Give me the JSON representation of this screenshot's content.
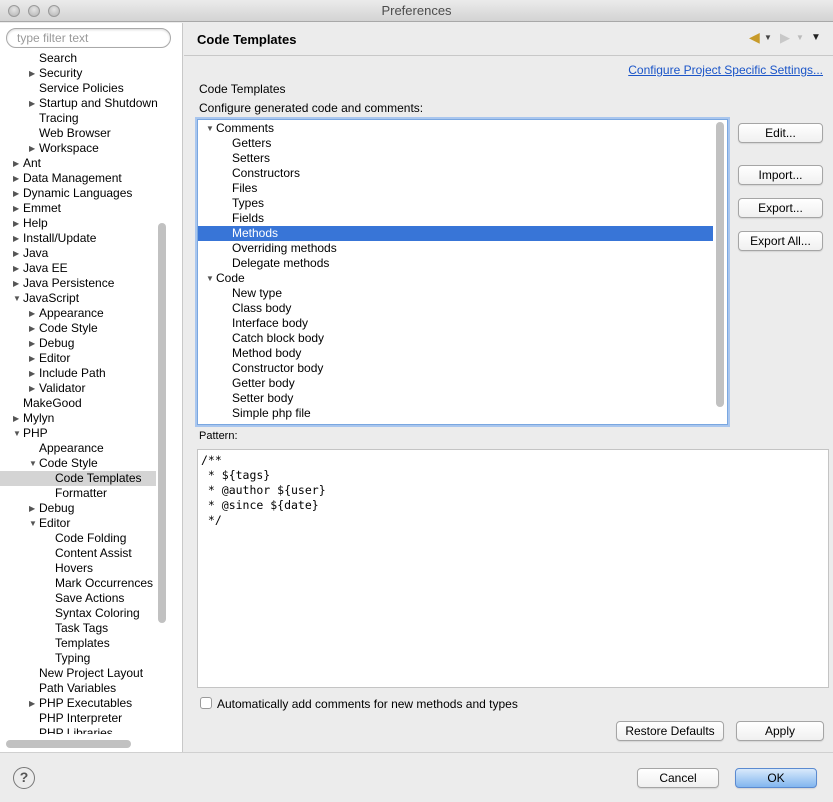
{
  "window": {
    "title": "Preferences"
  },
  "filter": {
    "placeholder": "type filter text"
  },
  "tree": [
    {
      "label": "Search",
      "level": 2,
      "twisty": ""
    },
    {
      "label": "Security",
      "level": 2,
      "twisty": "closed"
    },
    {
      "label": "Service Policies",
      "level": 2,
      "twisty": ""
    },
    {
      "label": "Startup and Shutdown",
      "level": 2,
      "twisty": "closed"
    },
    {
      "label": "Tracing",
      "level": 2,
      "twisty": ""
    },
    {
      "label": "Web Browser",
      "level": 2,
      "twisty": ""
    },
    {
      "label": "Workspace",
      "level": 2,
      "twisty": "closed"
    },
    {
      "label": "Ant",
      "level": 1,
      "twisty": "closed"
    },
    {
      "label": "Data Management",
      "level": 1,
      "twisty": "closed"
    },
    {
      "label": "Dynamic Languages",
      "level": 1,
      "twisty": "closed"
    },
    {
      "label": "Emmet",
      "level": 1,
      "twisty": "closed"
    },
    {
      "label": "Help",
      "level": 1,
      "twisty": "closed"
    },
    {
      "label": "Install/Update",
      "level": 1,
      "twisty": "closed"
    },
    {
      "label": "Java",
      "level": 1,
      "twisty": "closed"
    },
    {
      "label": "Java EE",
      "level": 1,
      "twisty": "closed"
    },
    {
      "label": "Java Persistence",
      "level": 1,
      "twisty": "closed"
    },
    {
      "label": "JavaScript",
      "level": 1,
      "twisty": "open"
    },
    {
      "label": "Appearance",
      "level": 2,
      "twisty": "closed"
    },
    {
      "label": "Code Style",
      "level": 2,
      "twisty": "closed"
    },
    {
      "label": "Debug",
      "level": 2,
      "twisty": "closed"
    },
    {
      "label": "Editor",
      "level": 2,
      "twisty": "closed"
    },
    {
      "label": "Include Path",
      "level": 2,
      "twisty": "closed"
    },
    {
      "label": "Validator",
      "level": 2,
      "twisty": "closed"
    },
    {
      "label": "MakeGood",
      "level": 1,
      "twisty": ""
    },
    {
      "label": "Mylyn",
      "level": 1,
      "twisty": "closed"
    },
    {
      "label": "PHP",
      "level": 1,
      "twisty": "open"
    },
    {
      "label": "Appearance",
      "level": 2,
      "twisty": ""
    },
    {
      "label": "Code Style",
      "level": 2,
      "twisty": "open"
    },
    {
      "label": "Code Templates",
      "level": 3,
      "twisty": "",
      "selected": true
    },
    {
      "label": "Formatter",
      "level": 3,
      "twisty": ""
    },
    {
      "label": "Debug",
      "level": 2,
      "twisty": "closed"
    },
    {
      "label": "Editor",
      "level": 2,
      "twisty": "open"
    },
    {
      "label": "Code Folding",
      "level": 3,
      "twisty": ""
    },
    {
      "label": "Content Assist",
      "level": 3,
      "twisty": ""
    },
    {
      "label": "Hovers",
      "level": 3,
      "twisty": ""
    },
    {
      "label": "Mark Occurrences",
      "level": 3,
      "twisty": ""
    },
    {
      "label": "Save Actions",
      "level": 3,
      "twisty": ""
    },
    {
      "label": "Syntax Coloring",
      "level": 3,
      "twisty": ""
    },
    {
      "label": "Task Tags",
      "level": 3,
      "twisty": ""
    },
    {
      "label": "Templates",
      "level": 3,
      "twisty": ""
    },
    {
      "label": "Typing",
      "level": 3,
      "twisty": ""
    },
    {
      "label": "New Project Layout",
      "level": 2,
      "twisty": ""
    },
    {
      "label": "Path Variables",
      "level": 2,
      "twisty": ""
    },
    {
      "label": "PHP Executables",
      "level": 2,
      "twisty": "closed"
    },
    {
      "label": "PHP Interpreter",
      "level": 2,
      "twisty": ""
    },
    {
      "label": "PHP Libraries",
      "level": 2,
      "twisty": ""
    }
  ],
  "page": {
    "title": "Code Templates",
    "config_link": "Configure Project Specific Settings...",
    "section_title": "Code Templates",
    "section_desc": "Configure generated code and comments:",
    "templates": [
      {
        "label": "Comments",
        "group": true
      },
      {
        "label": "Getters"
      },
      {
        "label": "Setters"
      },
      {
        "label": "Constructors"
      },
      {
        "label": "Files"
      },
      {
        "label": "Types"
      },
      {
        "label": "Fields"
      },
      {
        "label": "Methods",
        "selected": true
      },
      {
        "label": "Overriding methods"
      },
      {
        "label": "Delegate methods"
      },
      {
        "label": "Code",
        "group": true
      },
      {
        "label": "New type"
      },
      {
        "label": "Class body"
      },
      {
        "label": "Interface body"
      },
      {
        "label": "Catch block body"
      },
      {
        "label": "Method body"
      },
      {
        "label": "Constructor body"
      },
      {
        "label": "Getter body"
      },
      {
        "label": "Setter body"
      },
      {
        "label": "Simple php file"
      }
    ],
    "buttons": {
      "edit": "Edit...",
      "import": "Import...",
      "export": "Export...",
      "export_all": "Export All..."
    },
    "pattern_label": "Pattern:",
    "pattern_text": "/**\n * ${tags}\n * @author ${user}\n * @since ${date}\n */",
    "auto_comments_label": "Automatically add comments for new methods and types",
    "auto_comments_checked": false,
    "restore_defaults": "Restore Defaults",
    "apply": "Apply"
  },
  "footer": {
    "help": "?",
    "cancel": "Cancel",
    "ok": "OK"
  },
  "colors": {
    "selection": "#3875d7",
    "link": "#1b55c8",
    "default_button": "#82b6ef"
  }
}
